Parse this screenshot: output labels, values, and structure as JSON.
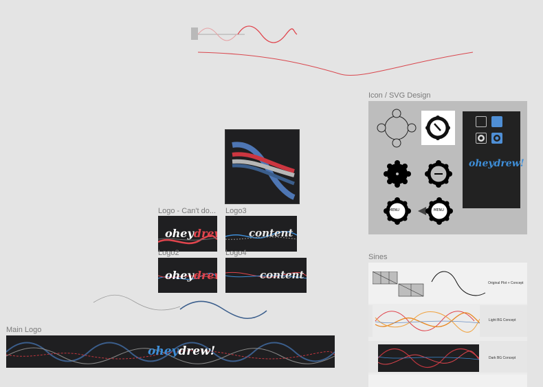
{
  "frames": {
    "icon_svg_design": "Icon / SVG Design",
    "sines": "Sines",
    "main_logo": "Main Logo",
    "logo_cant_do": "Logo - Can't do...",
    "logo2": "Logo2",
    "logo3": "Logo3",
    "logo4": "Logo4"
  },
  "logo_text": {
    "ohey": "ohey",
    "drew": "drew!",
    "content": "content"
  },
  "icons": {
    "menu_label": "MENU",
    "menu_label_small": "MENU"
  },
  "sines_cards": {
    "original": "Original Plot + Concept",
    "light": "Light BG Concept",
    "dark": "Dark BG Concept"
  },
  "colors": {
    "red": "#e0454d",
    "blue": "#3e8ed8",
    "navy": "#3b5e8c",
    "dark_bg": "#1f1f21",
    "canvas": "#e4e4e4"
  }
}
